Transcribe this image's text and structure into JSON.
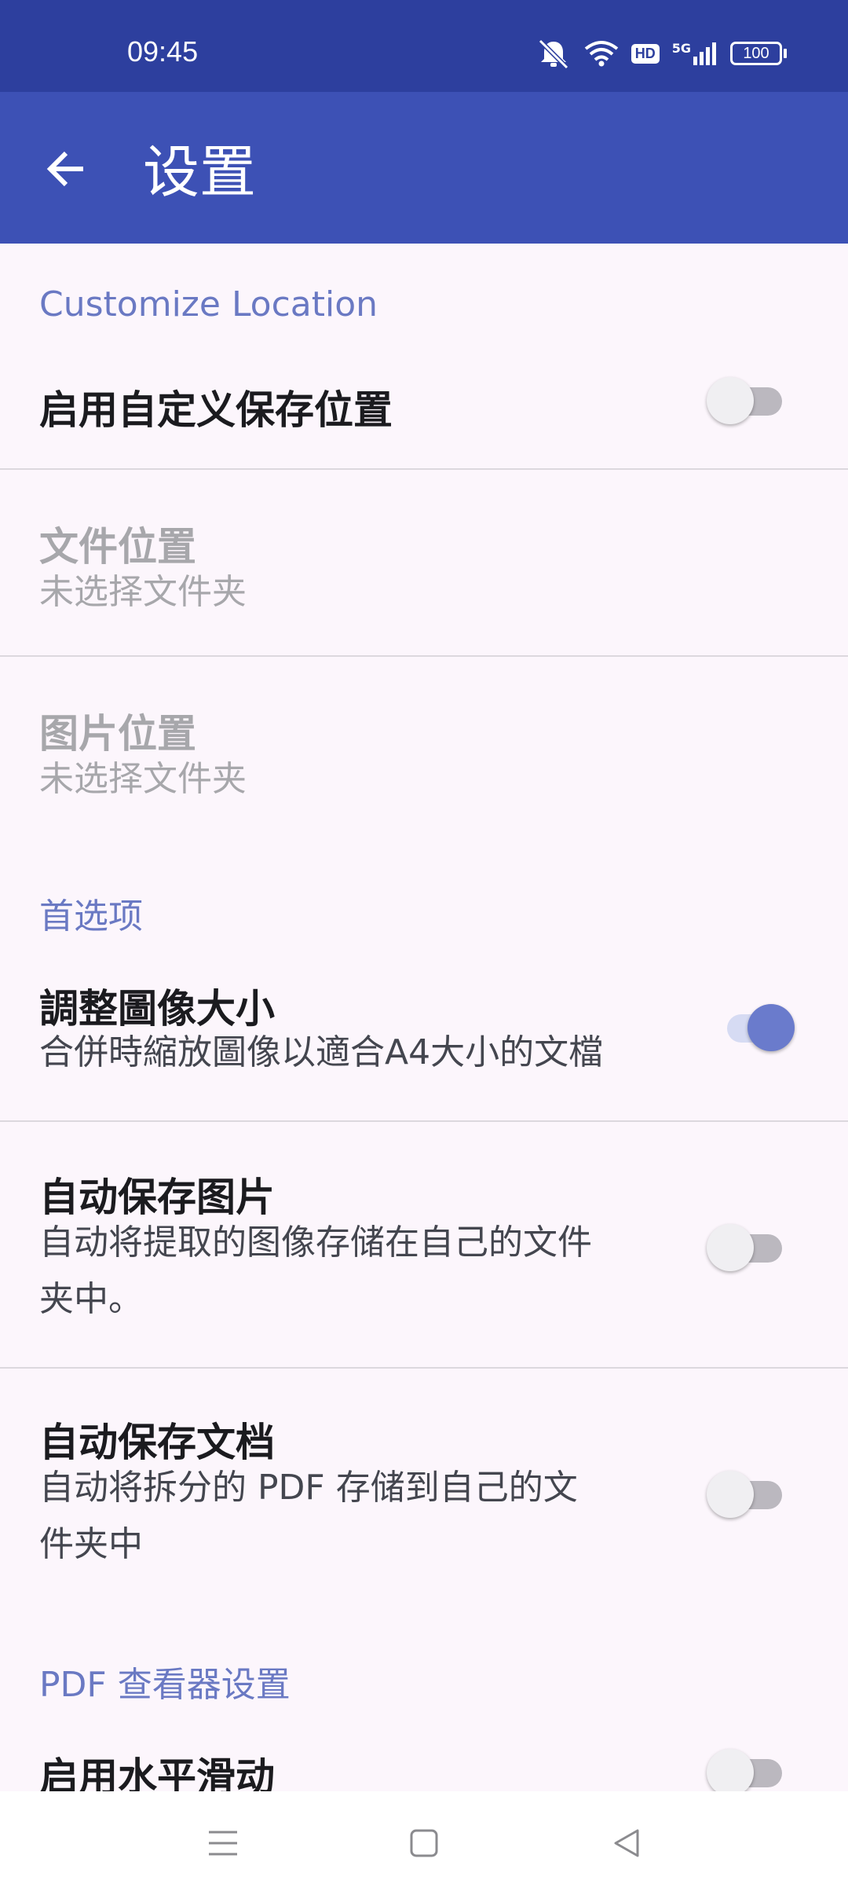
{
  "status_bar": {
    "time": "09:45",
    "icons": [
      "mute-icon",
      "wifi-icon",
      "hd-icon",
      "signal-5g-icon",
      "battery-icon"
    ],
    "hd_label": "HD",
    "network_label": "5G",
    "battery_level": "100"
  },
  "app_bar": {
    "title": "设置"
  },
  "sections": {
    "customize_location": {
      "header": "Customize Location",
      "enable_custom_location": {
        "title": "启用自定义保存位置",
        "enabled": false
      },
      "file_location": {
        "title": "文件位置",
        "summary": "未选择文件夹"
      },
      "image_location": {
        "title": "图片位置",
        "summary": "未选择文件夹"
      }
    },
    "preferences": {
      "header": "首选项",
      "resize_image": {
        "title": "調整圖像大小",
        "summary": "合併時縮放圖像以適合A4大小的文檔",
        "enabled": true
      },
      "auto_save_images": {
        "title": "自动保存图片",
        "summary_line1": "自动将提取的图像存储在自己的文件",
        "summary_line2": "夹中。",
        "enabled": false
      },
      "auto_save_documents": {
        "title": "自动保存文档",
        "summary_line1": "自动将拆分的 PDF 存储到自己的文",
        "summary_line2": "件夹中",
        "enabled": false
      }
    },
    "pdf_viewer": {
      "header": "PDF 查看器设置",
      "horizontal_scroll": {
        "title": "启用水平滑动",
        "enabled": false
      }
    }
  },
  "colors": {
    "status_bar": "#2d3f9e",
    "app_bar": "#3d51b5",
    "accent": "#6a79c3",
    "background": "#fcf6fc"
  }
}
